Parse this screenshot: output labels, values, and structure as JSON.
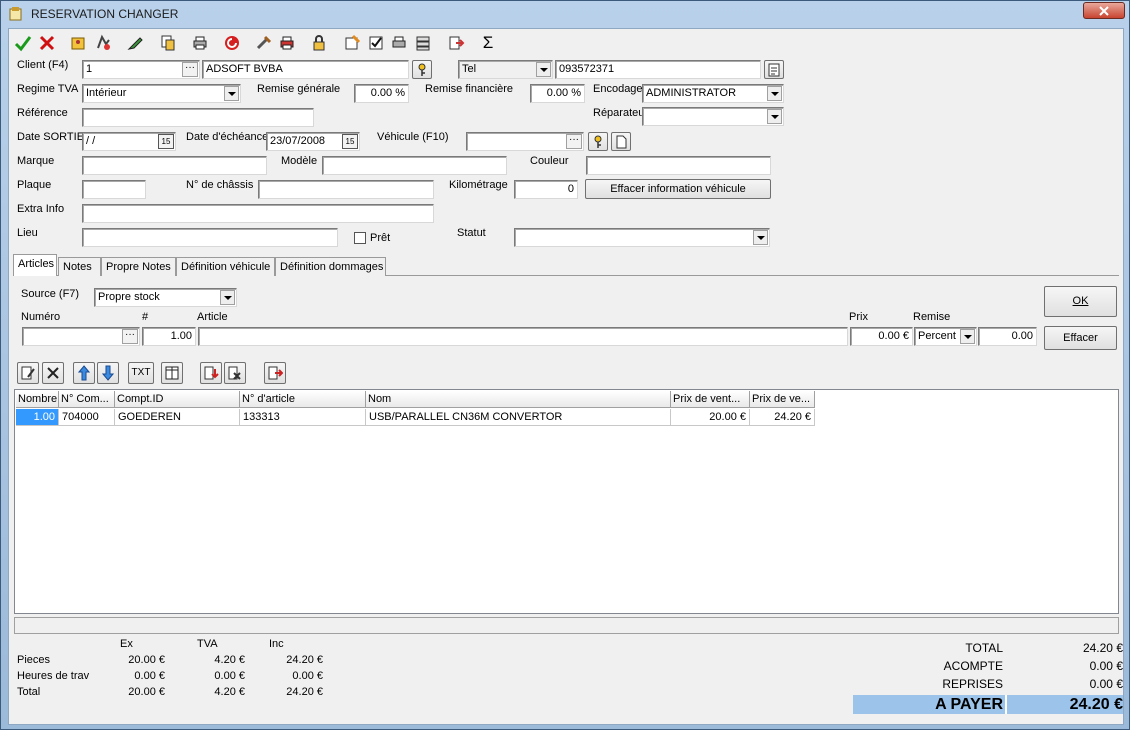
{
  "window": {
    "title": "RESERVATION CHANGER"
  },
  "toolbar": {
    "sigma": "Σ"
  },
  "client": {
    "label": "Client (F4)",
    "id": "1",
    "name": "ADSOFT BVBA",
    "phone_type": "Tel",
    "phone": "093572371"
  },
  "regime": {
    "label": "Regime TVA",
    "value": "Intérieur"
  },
  "remise_generale": {
    "label": "Remise générale",
    "value": "0.00 %"
  },
  "remise_financiere": {
    "label": "Remise financière",
    "value": "0.00 %"
  },
  "encodage": {
    "label": "Encodage",
    "value": "ADMINISTRATOR"
  },
  "reference": {
    "label": "Référence",
    "value": ""
  },
  "reparateur": {
    "label": "Réparateu",
    "value": ""
  },
  "date_sortie": {
    "label": "Date SORTIE",
    "value": " / /"
  },
  "date_echeance": {
    "label": "Date d'échéance",
    "value": "23/07/2008"
  },
  "vehicule": {
    "label": "Véhicule (F10)",
    "value": ""
  },
  "marque": {
    "label": "Marque",
    "value": ""
  },
  "modele": {
    "label": "Modèle",
    "value": ""
  },
  "couleur": {
    "label": "Couleur",
    "value": ""
  },
  "plaque": {
    "label": "Plaque",
    "value": ""
  },
  "chassis": {
    "label": "N° de châssis",
    "value": ""
  },
  "kilometrage": {
    "label": "Kilométrage",
    "value": "0"
  },
  "effacer_vehicule": "Effacer information véhicule",
  "extra_info": {
    "label": "Extra Info",
    "value": ""
  },
  "lieu": {
    "label": "Lieu",
    "value": ""
  },
  "pret": {
    "label": "Prêt"
  },
  "statut": {
    "label": "Statut",
    "value": ""
  },
  "tabs": [
    {
      "label": "Articles"
    },
    {
      "label": "Notes"
    },
    {
      "label": "Propre Notes"
    },
    {
      "label": "Définition véhicule"
    },
    {
      "label": "Définition dommages"
    }
  ],
  "article_entry": {
    "source_label": "Source (F7)",
    "source_value": "Propre stock",
    "numero_label": "Numéro",
    "count_label": "#",
    "article_label": "Article",
    "prix_label": "Prix",
    "remise_label": "Remise",
    "count_value": "1.00",
    "prix_value": "0.00 €",
    "remise_type": "Percent",
    "remise_value": "0.00",
    "ok": "OK",
    "effacer": "Effacer"
  },
  "grid_toolbar": {
    "txt": "TXT"
  },
  "grid": {
    "columns": [
      "Nombre",
      "N° Com...",
      "Compt.ID",
      "N° d'article",
      "Nom",
      "Prix de vent...",
      "Prix de ve..."
    ],
    "rows": [
      [
        "1.00",
        "704000",
        "GOEDEREN",
        "133313",
        "USB/PARALLEL CN36M CONVERTOR",
        "20.00 €",
        "24.20 €"
      ]
    ]
  },
  "summary": {
    "headers": [
      "Ex",
      "TVA",
      "Inc"
    ],
    "rows": [
      {
        "label": "Pieces",
        "ex": "20.00 €",
        "tva": "4.20 €",
        "inc": "24.20 €"
      },
      {
        "label": "Heures de trav",
        "ex": "0.00 €",
        "tva": "0.00 €",
        "inc": "0.00 €"
      },
      {
        "label": "Total",
        "ex": "20.00 €",
        "tva": "4.20 €",
        "inc": "24.20 €"
      }
    ]
  },
  "totals": {
    "total_label": "TOTAL",
    "total": "24.20 €",
    "acompte_label": "ACOMPTE",
    "acompte": "0.00 €",
    "reprises_label": "REPRISES",
    "reprises": "0.00 €",
    "payer_label": "A PAYER",
    "payer": "24.20 €"
  },
  "colors": {
    "accent": "#9cc3ea",
    "selection": "#3399ff"
  }
}
